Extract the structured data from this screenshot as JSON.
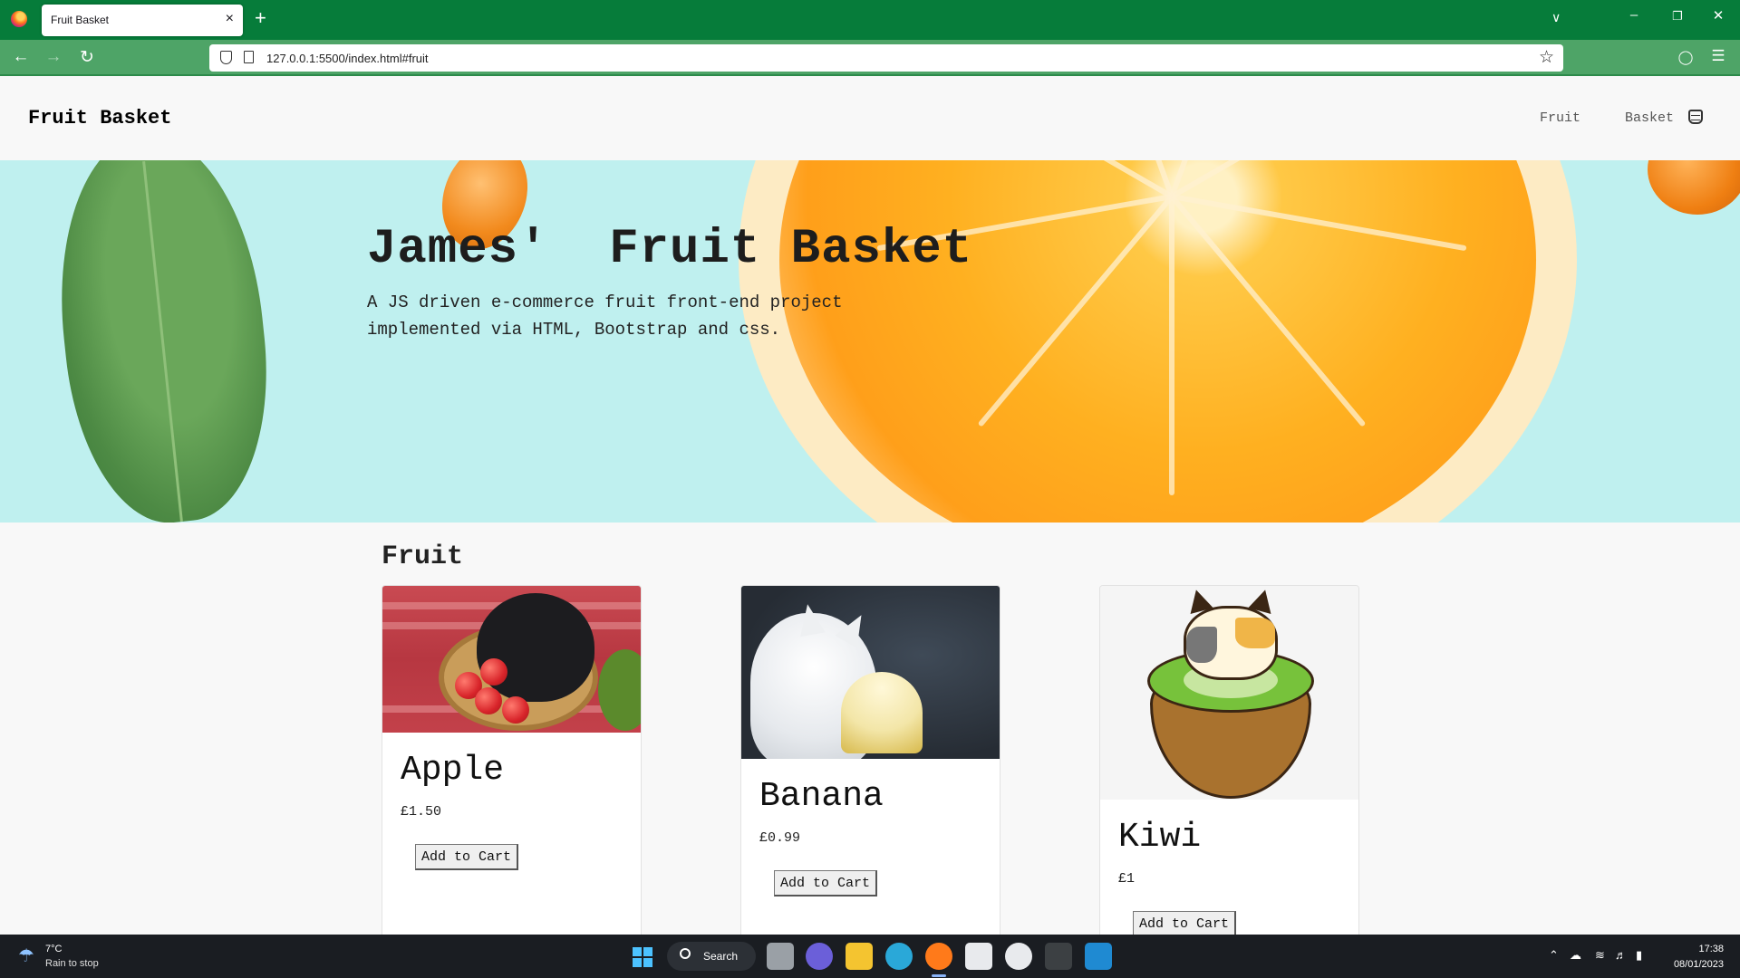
{
  "browser": {
    "tab_title": "Fruit Basket",
    "close_glyph": "×",
    "new_tab_glyph": "+",
    "url": "127.0.0.1:5500/index.html#fruit",
    "accent": "#067c3a"
  },
  "site": {
    "brand": "Fruit Basket",
    "nav": [
      "Fruit",
      "Basket"
    ]
  },
  "hero": {
    "title": "James'  Fruit Basket",
    "subtitle": "A JS driven e-commerce fruit front-end project implemented via HTML, Bootstrap and css."
  },
  "section": {
    "title": "Fruit"
  },
  "products": [
    {
      "name": "Apple",
      "price": "£1.50",
      "button": "Add to Cart",
      "image": "cat-with-apples"
    },
    {
      "name": "Banana",
      "price": "£0.99",
      "button": "Add to Cart",
      "image": "cat-eating-banana"
    },
    {
      "name": "Kiwi",
      "price": "£1",
      "button": "Add to Cart",
      "image": "cartoon-cat-in-kiwi"
    }
  ],
  "taskbar": {
    "weather_temp": "7°C",
    "weather_desc": "Rain to stop",
    "search_label": "Search",
    "time": "17:38",
    "date": "08/01/2023"
  }
}
